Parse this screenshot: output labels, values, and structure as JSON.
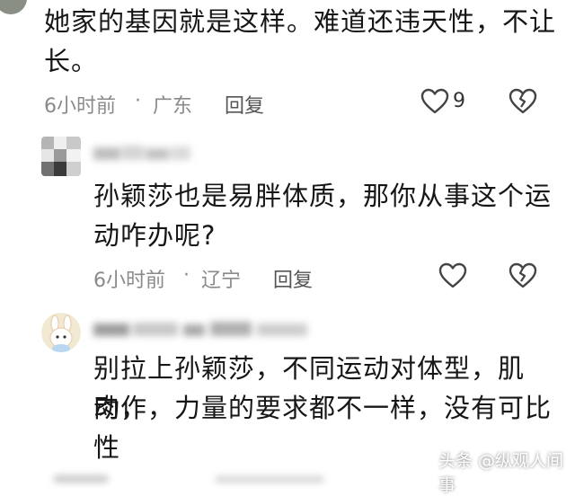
{
  "comments": [
    {
      "text_line1": "她家的基因就是这样。难道还违天性，不让",
      "text_line2": "长。",
      "time": "6小时前",
      "dot": "·",
      "region": "广东",
      "reply_label": "回复",
      "like_count": "9"
    },
    {
      "username": "",
      "text_line1": "孙颖莎也是易胖体质，那你从事这个运",
      "text_line2": "动咋办呢?",
      "time": "6小时前",
      "dot": "·",
      "region": "辽宁",
      "reply_label": "回复"
    },
    {
      "username": "",
      "text_line1": "别拉上孙颖莎，不同运动对体型，肌肉，",
      "text_line2": "动作，力量的要求都不一样，没有可比",
      "text_line3": "性"
    }
  ],
  "watermark": "头条 @纵观人间事",
  "icons": {
    "like": "heart-outline-icon",
    "dislike": "broken-heart-icon"
  },
  "colors": {
    "meta": "#8a8a8a",
    "text": "#161616"
  }
}
